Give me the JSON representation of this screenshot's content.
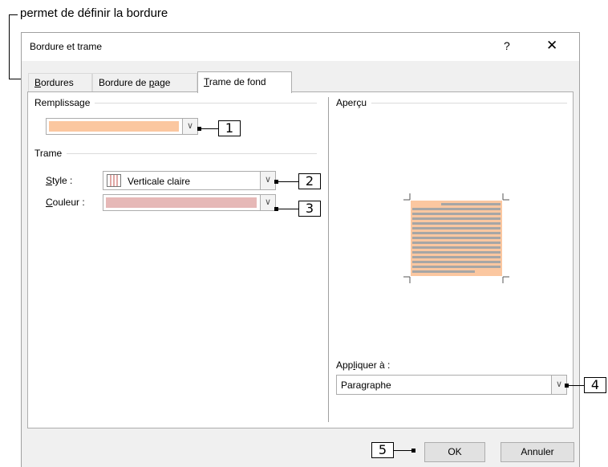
{
  "callouts": {
    "top_label": "permet de définir la bordure",
    "numbers": [
      "1",
      "2",
      "3",
      "4",
      "5"
    ]
  },
  "dialog": {
    "title": "Bordure et trame",
    "help_label": "?",
    "close_label": "✕"
  },
  "tabs": {
    "borders": {
      "mnemonic": "B",
      "rest": "ordures"
    },
    "page_border": {
      "before": "Bordure de ",
      "mnemonic": "p",
      "after": "age"
    },
    "shading": {
      "mnemonic": "T",
      "rest": "rame de fond"
    }
  },
  "fill": {
    "group_label": "Remplissage",
    "color": "#fbc7a0"
  },
  "pattern": {
    "group_label": "Trame",
    "style_label": {
      "mnemonic": "S",
      "rest": "tyle :"
    },
    "style_value": "Verticale claire",
    "color_label": {
      "mnemonic": "C",
      "rest": "ouleur :"
    },
    "color_value": "#e6b8b7"
  },
  "preview": {
    "group_label": "Aperçu",
    "apply_label": {
      "before": "App",
      "mnemonic": "l",
      "after": "iquer à :"
    },
    "apply_value": "Paragraphe"
  },
  "buttons": {
    "ok": "OK",
    "cancel": "Annuler"
  },
  "colors": {
    "accent_fill": "#fbc7a0",
    "pattern_color": "#e6b8b7",
    "preview_text_lines": "#a6a6a6"
  }
}
